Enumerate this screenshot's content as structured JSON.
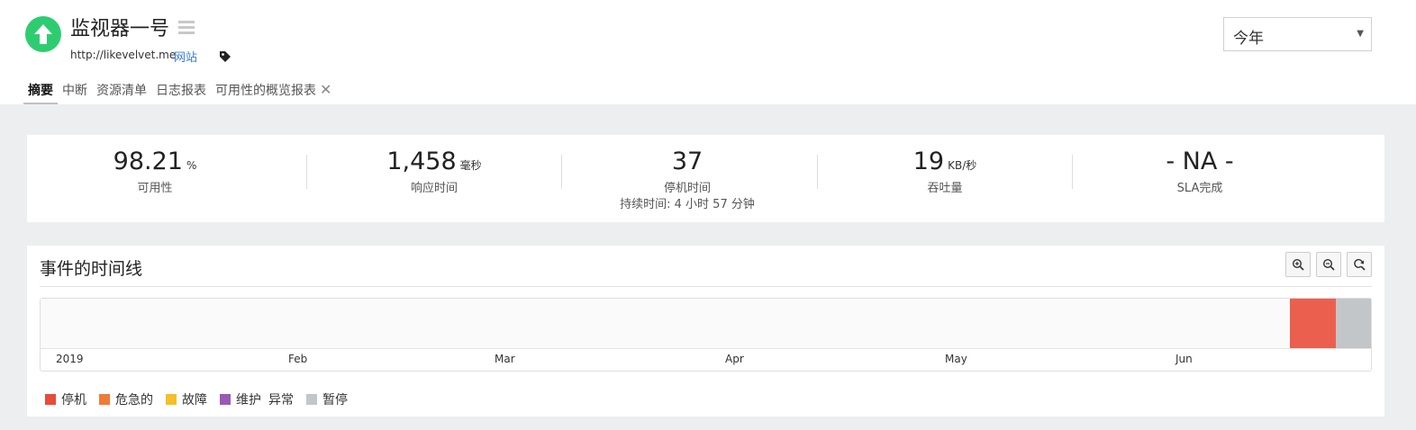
{
  "header": {
    "title": "监视器一号",
    "url": "http://likevelvet.me",
    "site_link": "网站",
    "status_icon": "arrow-up-icon",
    "status_color": "#2ecc71"
  },
  "period_select": {
    "value": "今年"
  },
  "tabs": [
    {
      "label": "摘要",
      "active": true
    },
    {
      "label": "中断"
    },
    {
      "label": "资源清单"
    },
    {
      "label": "日志报表"
    },
    {
      "label": "可用性的概览报表"
    }
  ],
  "stats": {
    "availability": {
      "value": "98.21",
      "unit": "%",
      "label": "可用性"
    },
    "response": {
      "value": "1,458",
      "unit": "毫秒",
      "label": "响应时间"
    },
    "downtime": {
      "value": "37",
      "label": "停机时间",
      "sub": "持续时间: 4 小时 57 分钟"
    },
    "throughput": {
      "value": "19",
      "unit": "KB/秒",
      "label": "吞吐量"
    },
    "sla": {
      "value": "- NA -",
      "label": "SLA完成"
    }
  },
  "timeline": {
    "title": "事件的时间线",
    "months": [
      "2019",
      "Feb",
      "Mar",
      "Apr",
      "May",
      "Jun"
    ],
    "segments": [
      {
        "status": "停机",
        "color": "#eb5f4f"
      },
      {
        "status": "暂停",
        "color": "#c3c6c9"
      }
    ],
    "legend": [
      {
        "label": "停机",
        "color": "#e74c3c"
      },
      {
        "label": "危急的",
        "color": "#f07b39"
      },
      {
        "label": "故障",
        "color": "#f5bf29"
      },
      {
        "label": "维护",
        "color": "#9b59b6"
      },
      {
        "label": "异常"
      },
      {
        "label": "暂停",
        "color": "#c3c6c9"
      }
    ]
  }
}
